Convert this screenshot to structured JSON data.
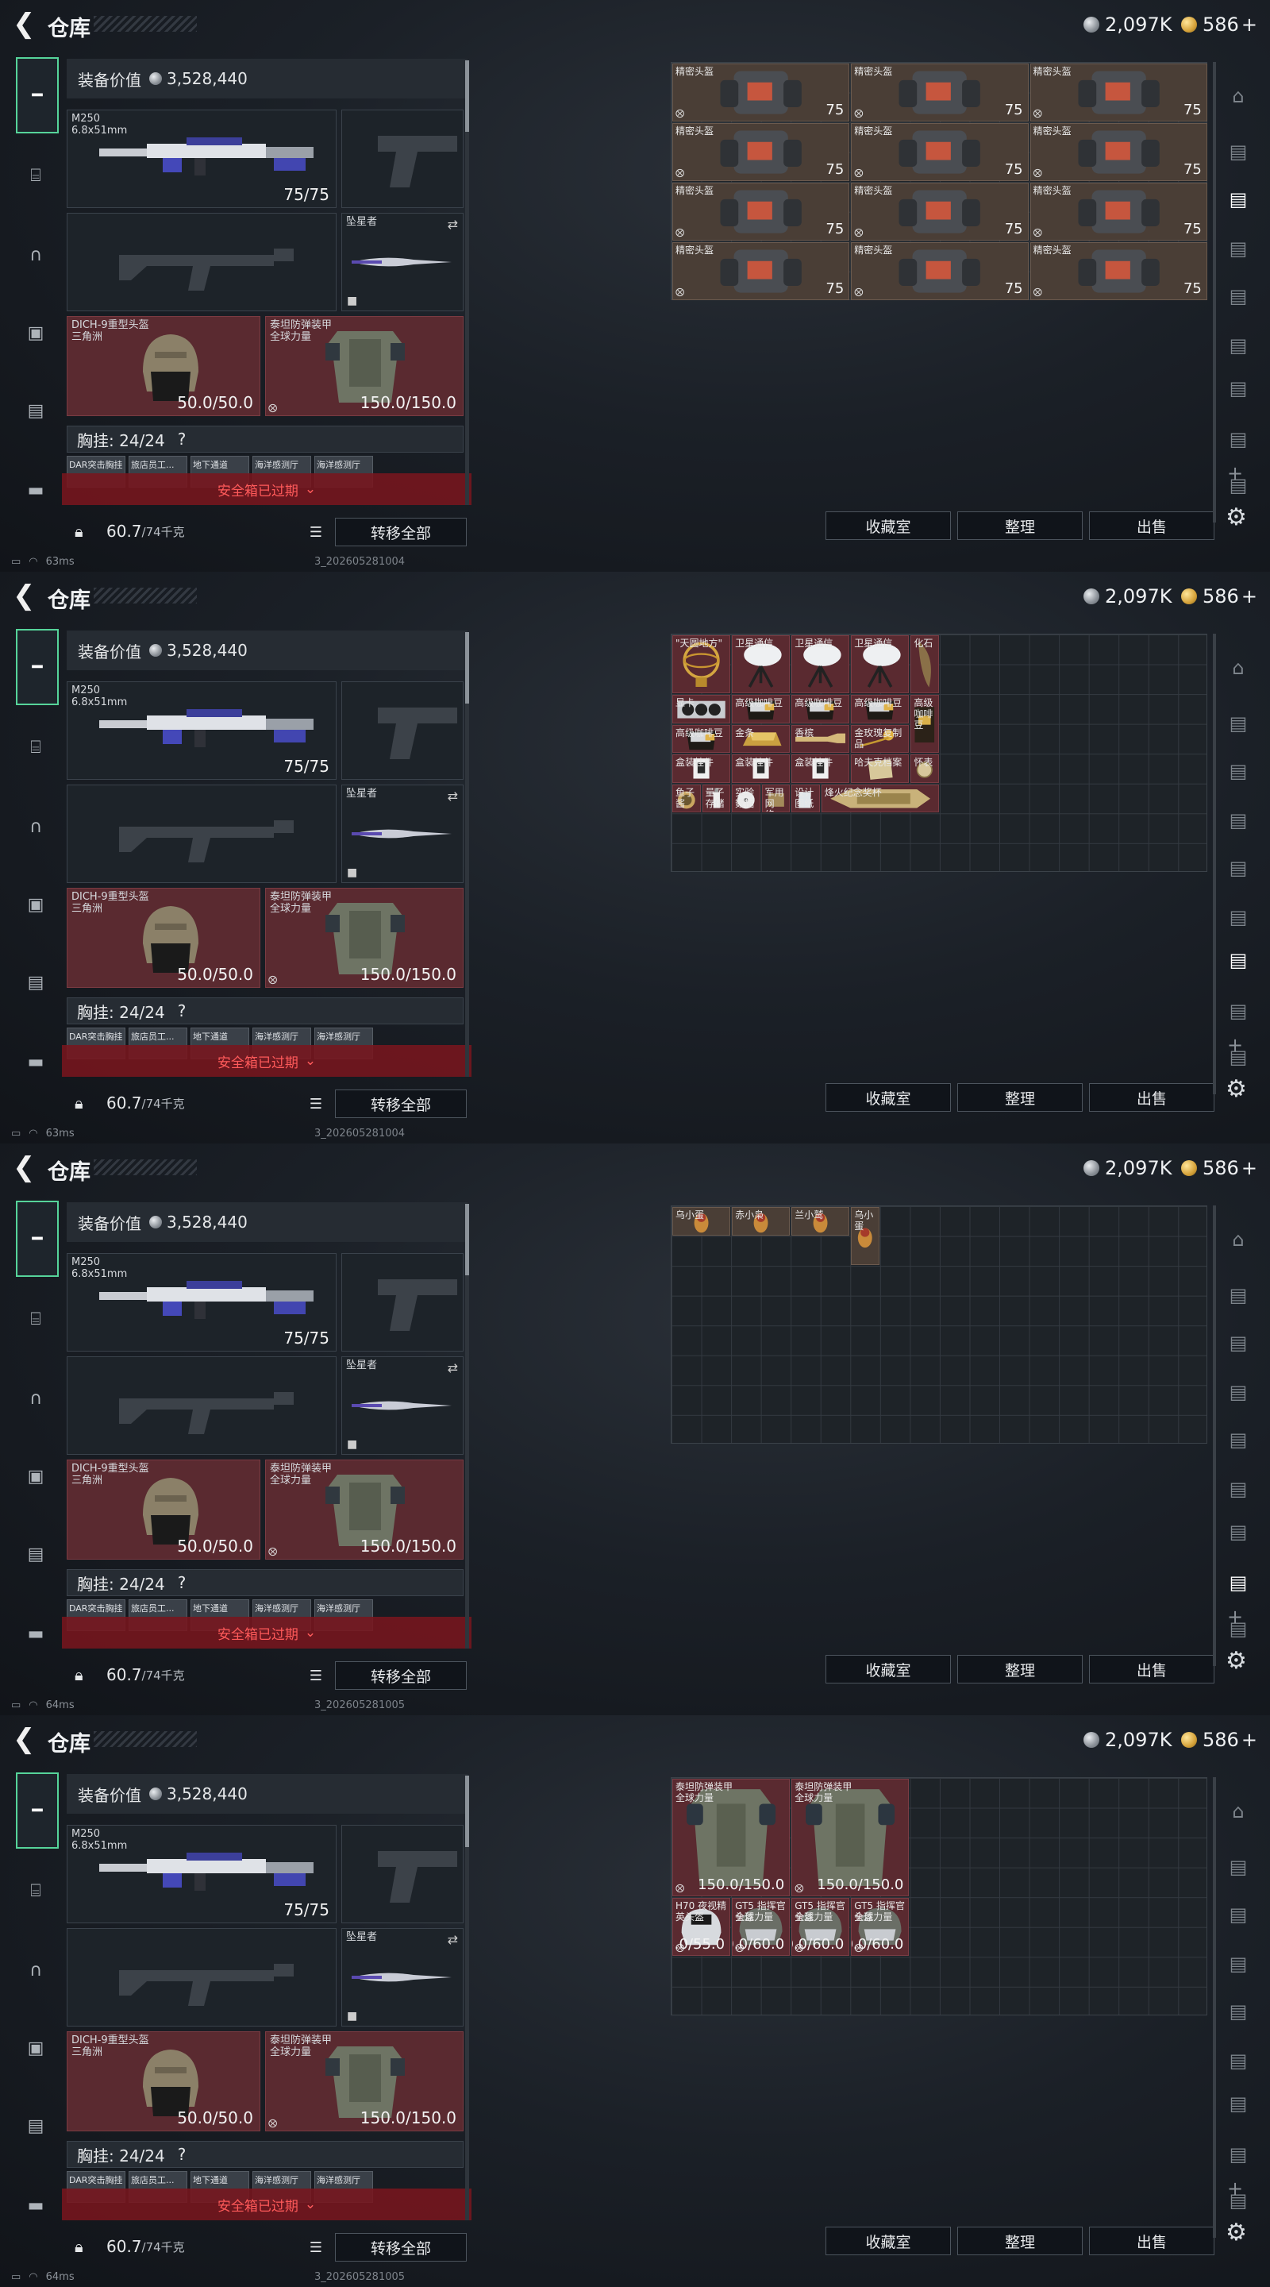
{
  "header": {
    "title": "仓库",
    "silver": "2,097K",
    "gold": "586",
    "gold_plus": "+"
  },
  "left": {
    "value_label": "装备价值",
    "value": "3,528,440",
    "rifle": {
      "name": "M250",
      "ammo": "6.8x51mm",
      "count": "75/75"
    },
    "melee": {
      "name": "坠星者"
    },
    "helmet": {
      "name": "DICH-9重型头盔",
      "sub": "三角洲",
      "dur": "50.0/50.0"
    },
    "armor": {
      "name": "泰坦防弹装甲",
      "sub": "全球力量",
      "dur": "150.0/150.0"
    },
    "chest_label": "胸挂: 24/24",
    "chest_q": "?",
    "chest_items": [
      "DAR突击胸挂",
      "旅店员工...",
      "地下通道",
      "海洋感测厅",
      "海洋感测厅"
    ],
    "expired": "安全箱已过期",
    "weight": "60.7",
    "weight_unit": "/74千克",
    "transfer": "转移全部"
  },
  "tabs": [
    "weapon-tab",
    "armor-tab",
    "helmet-tab",
    "backpack-tab",
    "case-tab",
    "toolbox-tab"
  ],
  "buttons": {
    "collection": "收藏室",
    "sort": "整理",
    "sell": "出售"
  },
  "screens": [
    {
      "ping": "63ms",
      "version": "3_202605281004",
      "active_rs": 2,
      "items": [
        {
          "label": "精密头盔",
          "dur": "75"
        },
        {
          "label": "精密头盔",
          "dur": "75"
        },
        {
          "label": "精密头盔",
          "dur": "75"
        },
        {
          "label": "精密头盔",
          "dur": "75"
        },
        {
          "label": "精密头盔",
          "dur": "75"
        },
        {
          "label": "精密头盔",
          "dur": "75"
        },
        {
          "label": "精密头盔",
          "dur": "75"
        },
        {
          "label": "精密头盔",
          "dur": "75"
        },
        {
          "label": "精密头盔",
          "dur": "75"
        },
        {
          "label": "精密头盔",
          "dur": "75"
        },
        {
          "label": "精密头盔",
          "dur": "75"
        },
        {
          "label": "精密头盔",
          "dur": "75"
        }
      ]
    },
    {
      "ping": "63ms",
      "version": "3_202605281004",
      "active_rs": 6,
      "items": [
        {
          "label": "\"天圆地方\""
        },
        {
          "label": "卫星通信"
        },
        {
          "label": "卫星通信"
        },
        {
          "label": "卫星通信"
        },
        {
          "label": "化石"
        },
        {
          "label": "显卡"
        },
        {
          "label": "高级咖啡豆"
        },
        {
          "label": "高级咖啡豆"
        },
        {
          "label": "高级咖啡豆"
        },
        {
          "label": "高级咖啡豆"
        },
        {
          "label": "高级咖啡豆"
        },
        {
          "label": "金条"
        },
        {
          "label": "香槟"
        },
        {
          "label": "金玫瑰复制品"
        },
        {
          "label": "盒装挂件"
        },
        {
          "label": "盒装挂件"
        },
        {
          "label": "盒装挂件"
        },
        {
          "label": "哈夫克档案"
        },
        {
          "label": "怀表"
        },
        {
          "label": "鱼子酱"
        },
        {
          "label": "量子存储"
        },
        {
          "label": "实验数据"
        },
        {
          "label": "军用网络..."
        },
        {
          "label": "设计图纸"
        },
        {
          "label": "烽火纪念奖杯"
        }
      ]
    },
    {
      "ping": "64ms",
      "version": "3_202605281005",
      "active_rs": 7,
      "items": [
        {
          "label": "乌小蛋"
        },
        {
          "label": "赤小枭"
        },
        {
          "label": "兰小鹫"
        },
        {
          "label": "乌小蛋"
        }
      ]
    },
    {
      "ping": "64ms",
      "version": "3_202605281005",
      "active_rs": 9,
      "items": [
        {
          "label": "泰坦防弹装甲",
          "sub": "全球力量",
          "dur": "150.0/150.0"
        },
        {
          "label": "泰坦防弹装甲",
          "sub": "全球力量",
          "dur": "150.0/150.0"
        },
        {
          "label": "H70 夜视精英头盔",
          "sub": "",
          "dur": "55.0/55.0"
        },
        {
          "label": "GT5 指挥官头盔",
          "sub": "全球力量",
          "dur": "60.0/60.0"
        },
        {
          "label": "GT5 指挥官头盔",
          "sub": "全球力量",
          "dur": "60.0/60.0"
        },
        {
          "label": "GT5 指挥官头盔",
          "sub": "全球力量",
          "dur": "60.0/60.0"
        }
      ]
    }
  ]
}
